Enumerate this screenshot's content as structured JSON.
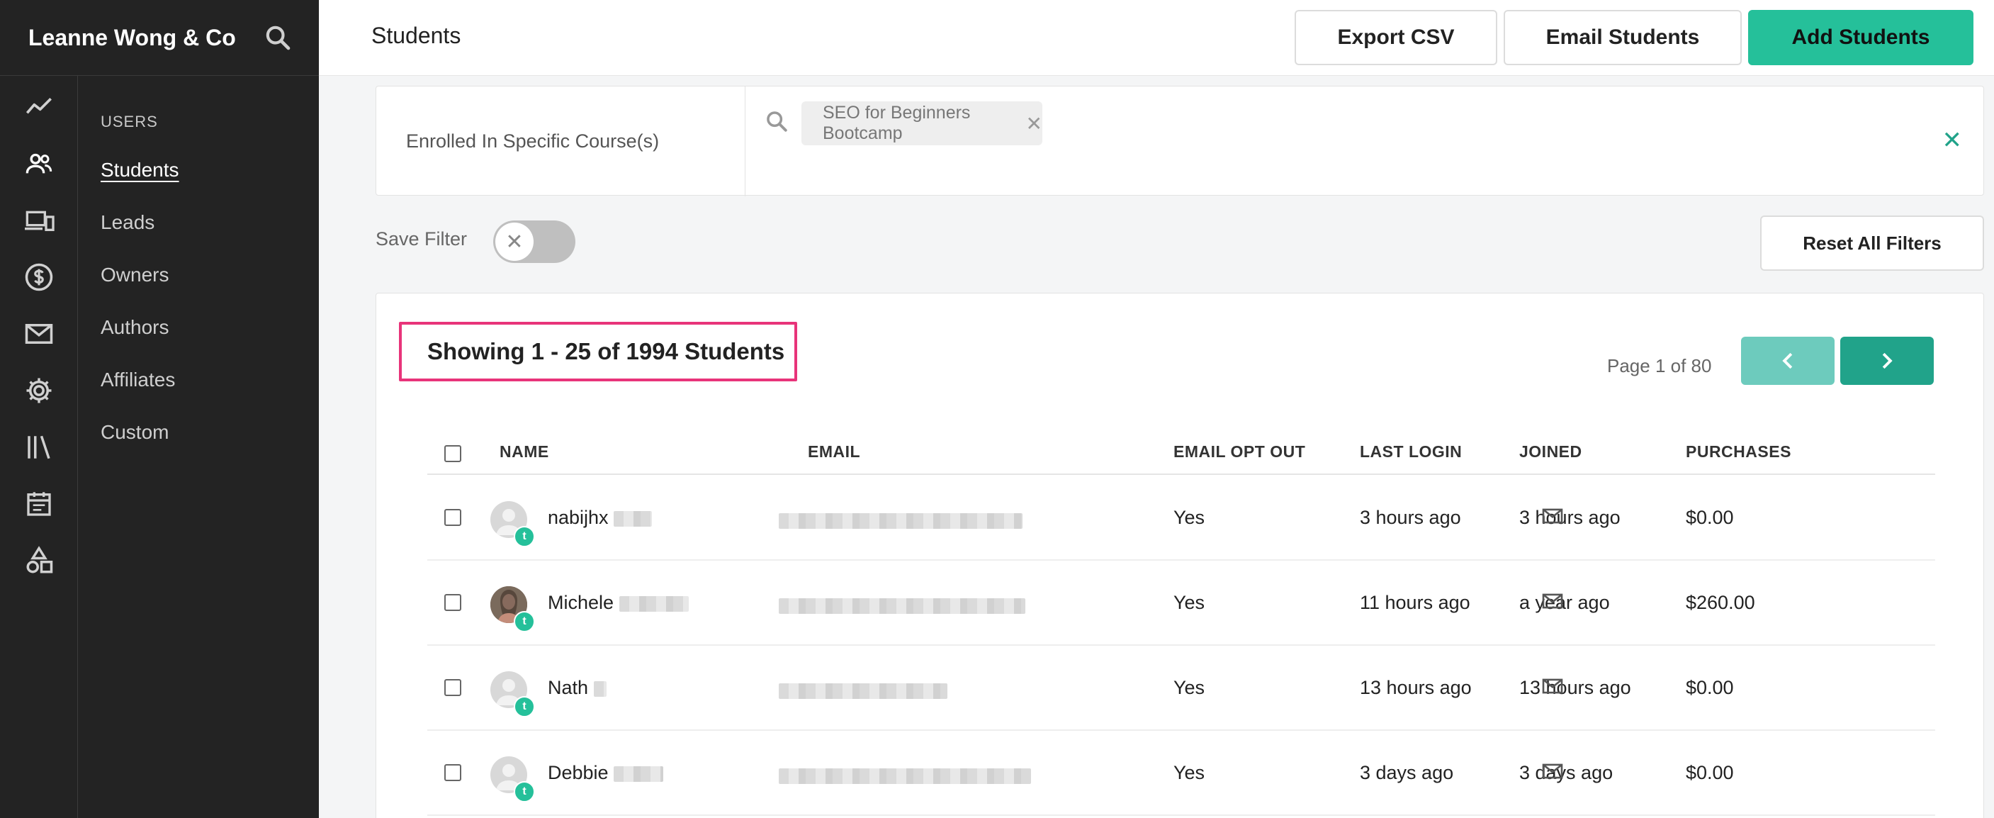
{
  "app": {
    "brand": "Leanne Wong & Co"
  },
  "sidebar": {
    "rail_icons": [
      "analytics-icon",
      "users-icon",
      "devices-icon",
      "dollar-icon",
      "mail-icon",
      "settings-icon",
      "library-icon",
      "calendar-icon",
      "shapes-icon"
    ],
    "section": "USERS",
    "items": [
      {
        "label": "Students",
        "active": true
      },
      {
        "label": "Leads"
      },
      {
        "label": "Owners"
      },
      {
        "label": "Authors"
      },
      {
        "label": "Affiliates"
      },
      {
        "label": "Custom"
      }
    ]
  },
  "header": {
    "title": "Students",
    "export_label": "Export CSV",
    "email_label": "Email Students",
    "add_label": "Add Students"
  },
  "filter": {
    "label": "Enrolled In Specific Course(s)",
    "chip": "SEO for Beginners Bootcamp"
  },
  "save_filter": {
    "label": "Save Filter",
    "enabled": false,
    "reset_label": "Reset All Filters"
  },
  "table": {
    "showing": "Showing 1 - 25 of 1994 Students",
    "page_info": "Page 1 of 80",
    "columns": [
      "NAME",
      "EMAIL",
      "EMAIL OPT OUT",
      "LAST LOGIN",
      "JOINED",
      "PURCHASES"
    ],
    "rows": [
      {
        "name": "nabijhx",
        "opt_out": "Yes",
        "last_login": "3 hours ago",
        "joined": "3 hours ago",
        "purchases": "$0.00"
      },
      {
        "name": "Michele",
        "opt_out": "Yes",
        "last_login": "11 hours ago",
        "joined": "a year ago",
        "purchases": "$260.00"
      },
      {
        "name": "Nath",
        "opt_out": "Yes",
        "last_login": "13 hours ago",
        "joined": "13 hours ago",
        "purchases": "$0.00"
      },
      {
        "name": "Debbie",
        "opt_out": "Yes",
        "last_login": "3 days ago",
        "joined": "3 days ago",
        "purchases": "$0.00"
      }
    ],
    "badge_letter": "t"
  },
  "colors": {
    "accent": "#25c09a",
    "accent_dark": "#21a38a",
    "highlight": "#e8347a",
    "sidebar_bg": "#232323"
  }
}
